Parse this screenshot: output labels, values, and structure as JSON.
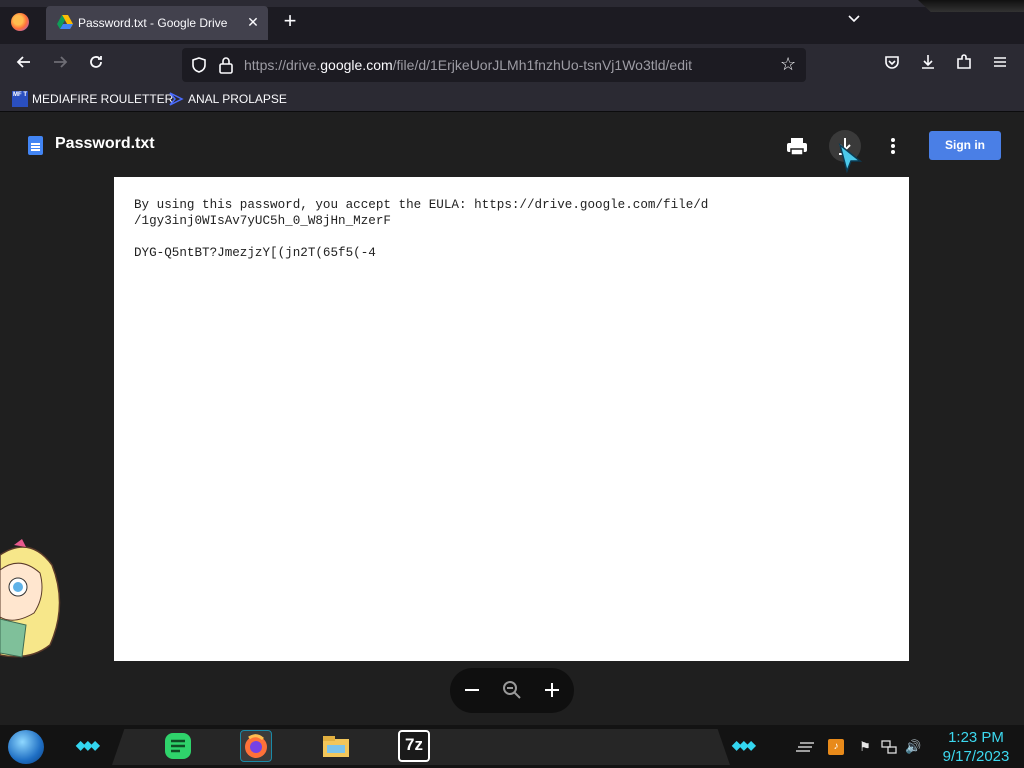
{
  "browser": {
    "tab": {
      "title": "Password.txt - Google Drive"
    },
    "url": {
      "prefix": "https://drive.",
      "domain": "google.com",
      "path": "/file/d/1ErjkeUorJLMh1fnzhUo-tsnVj1Wo3tld/edit"
    },
    "bookmarks": [
      {
        "label": "MEDIAFIRE ROULETTER",
        "icon_text": "MF T"
      },
      {
        "label": "ANAL PROLAPSE"
      }
    ]
  },
  "viewer": {
    "filename": "Password.txt",
    "sign_in_label": "Sign in",
    "content": "By using this password, you accept the EULA: https://drive.google.com/file/d\n/1gy3inj0WIsAv7yUC5h_0_W8jHn_MzerF\n\nDYG-Q5ntBT?JmezjzY[(jn2T(65f5(-4"
  },
  "taskbar": {
    "time": "1:23 PM",
    "date": "9/17/2023",
    "seven_zip_label": "7z"
  },
  "colors": {
    "accent": "#4a7fe6",
    "taskbar_accent": "#3cd8ef"
  },
  "icons": [
    "firefox-icon",
    "drive-icon",
    "close-icon",
    "plus-icon",
    "chevron-down-icon",
    "back-icon",
    "forward-icon",
    "reload-icon",
    "shield-icon",
    "lock-icon",
    "star-icon",
    "pocket-icon",
    "download-icon",
    "extensions-icon",
    "menu-icon",
    "print-icon",
    "more-icon",
    "zoom-out-icon",
    "zoom-icon",
    "zoom-in-icon"
  ]
}
